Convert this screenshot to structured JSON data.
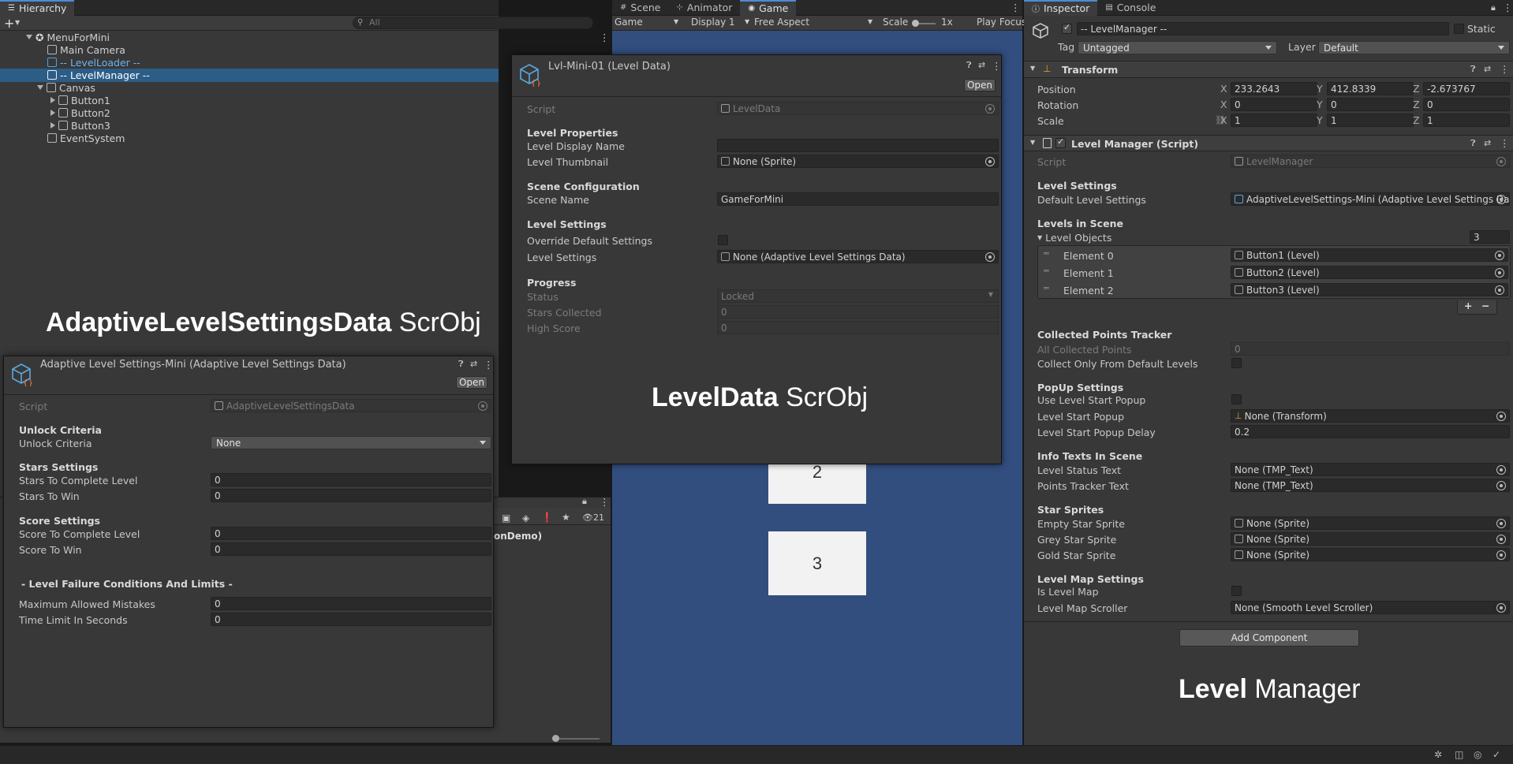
{
  "hierarchy": {
    "tab": "Hierarchy",
    "search_placeholder": "All",
    "scene": "MenuForMini",
    "items": [
      "Main Camera",
      "-- LevelLoader --",
      "-- LevelManager --",
      "Canvas",
      "Button1",
      "Button2",
      "Button3",
      "EventSystem"
    ]
  },
  "center_tabs": [
    "Scene",
    "Animator",
    "Game"
  ],
  "game_toolbar": {
    "mode": "Game",
    "display": "Display 1",
    "aspect": "Free Aspect",
    "scale_label": "Scale",
    "scale_value": "1x",
    "play_focus": "Play Focus"
  },
  "game_buttons": [
    "2",
    "3"
  ],
  "project_panel": {
    "count": "21",
    "item": "onDemo)"
  },
  "level_data_win": {
    "title": "Lvl-Mini-01 (Level Data)",
    "open": "Open",
    "script_label": "Script",
    "script_value": "LevelData",
    "h1": "Level Properties",
    "display_name": "Level Display Name",
    "display_name_value": "",
    "thumbnail": "Level Thumbnail",
    "thumbnail_value": "None (Sprite)",
    "h2": "Scene Configuration",
    "scene_name": "Scene Name",
    "scene_name_value": "GameForMini",
    "h3": "Level Settings",
    "override": "Override Default Settings",
    "level_settings": "Level Settings",
    "level_settings_value": "None (Adaptive Level Settings Data)",
    "h4": "Progress",
    "status": "Status",
    "status_value": "Locked",
    "stars": "Stars Collected",
    "stars_value": "0",
    "score": "High Score",
    "score_value": "0",
    "caption_bold": "LevelData",
    "caption_rest": " ScrObj"
  },
  "adaptive_win": {
    "title": "Adaptive Level Settings-Mini (Adaptive Level Settings Data)",
    "open": "Open",
    "script_label": "Script",
    "script_value": "AdaptiveLevelSettingsData",
    "h1": "Unlock Criteria",
    "unlock": "Unlock Criteria",
    "unlock_value": "None",
    "h2": "Stars Settings",
    "stars_complete": "Stars To Complete Level",
    "stars_complete_value": "0",
    "stars_win": "Stars To Win",
    "stars_win_value": "0",
    "h3": "Score Settings",
    "score_complete": "Score To Complete Level",
    "score_complete_value": "0",
    "score_win": "Score To Win",
    "score_win_value": "0",
    "h4": "- Level Failure Conditions And Limits -",
    "mistakes": "Maximum Allowed Mistakes",
    "mistakes_value": "0",
    "time": "Time Limit In Seconds",
    "time_value": "0",
    "caption_bold": "AdaptiveLevelSettingsData",
    "caption_rest": " ScrObj"
  },
  "inspector": {
    "tabs": [
      "Inspector",
      "Console"
    ],
    "object_name": "-- LevelManager --",
    "static": "Static",
    "tag_label": "Tag",
    "tag_value": "Untagged",
    "layer_label": "Layer",
    "layer_value": "Default",
    "transform": {
      "title": "Transform",
      "position": "Position",
      "rotation": "Rotation",
      "scale": "Scale",
      "pos": [
        "233.2643",
        "412.8339",
        "-2.673767"
      ],
      "rot": [
        "0",
        "0",
        "0"
      ],
      "scl": [
        "1",
        "1",
        "1"
      ],
      "axes": [
        "X",
        "Y",
        "Z"
      ]
    },
    "component": {
      "title": "Level Manager (Script)",
      "script_label": "Script",
      "script_value": "LevelManager",
      "h_level": "Level Settings",
      "default_settings": "Default Level Settings",
      "default_settings_value": "AdaptiveLevelSettings-Mini (Adaptive Level Settings Dat",
      "h_levels": "Levels in Scene",
      "level_objects": "Level Objects",
      "level_objects_count": "3",
      "elements": [
        {
          "label": "Element 0",
          "value": "Button1 (Level)"
        },
        {
          "label": "Element 1",
          "value": "Button2 (Level)"
        },
        {
          "label": "Element 2",
          "value": "Button3 (Level)"
        }
      ],
      "plus": "+",
      "minus": "−",
      "h_points": "Collected Points Tracker",
      "all_points": "All Collected Points",
      "all_points_value": "0",
      "collect_only": "Collect Only From Default Levels",
      "h_popup": "PopUp Settings",
      "use_popup": "Use Level Start Popup",
      "popup": "Level Start Popup",
      "popup_value": "None (Transform)",
      "popup_delay": "Level Start Popup Delay",
      "popup_delay_value": "0.2",
      "h_info": "Info Texts In Scene",
      "status_text": "Level Status Text",
      "status_text_value": "None (TMP_Text)",
      "points_text": "Points Tracker Text",
      "points_text_value": "None (TMP_Text)",
      "h_stars": "Star Sprites",
      "empty_star": "Empty Star Sprite",
      "grey_star": "Grey Star Sprite",
      "gold_star": "Gold Star Sprite",
      "sprite_value": "None (Sprite)",
      "h_map": "Level Map Settings",
      "is_map": "Is Level Map",
      "map_scroller": "Level Map Scroller",
      "map_scroller_value": "None (Smooth Level Scroller)"
    },
    "add_component": "Add Component",
    "caption_bold": "Level",
    "caption_rest": " Manager"
  }
}
